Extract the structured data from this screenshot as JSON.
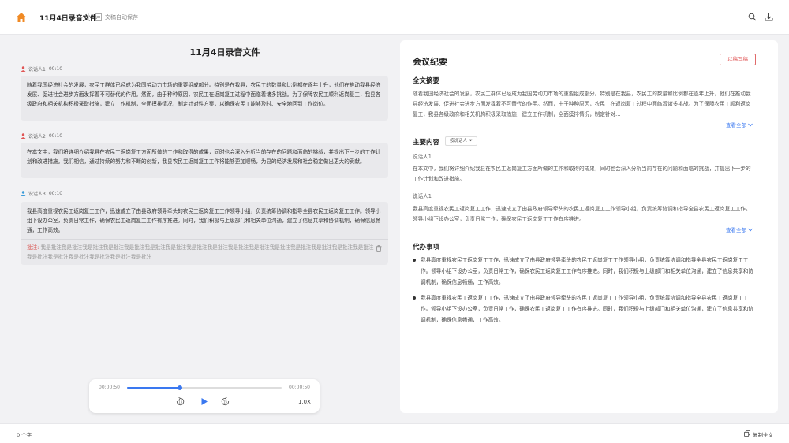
{
  "header": {
    "title": "11月4日录音文件",
    "save_status": "文稿自动保存"
  },
  "transcript": {
    "title": "11月4日录音文件",
    "entries": [
      {
        "speaker": "说话人1",
        "time": "00:10",
        "speaker_color": "#e05555",
        "text": "随着我国经济社会的发展，农民工群体已经成为我国劳动力市场的重要组成部分。特别是在我县，农民工的数量和比例都在逐年上升，他们在推动我县经济发展、促进社会进步方面发挥着不可替代的作用。然而，由于种种原因，农民工在返岗复工过程中面临着诸多挑战。为了保障农民工顺利返岗复工，我县各级政府和相关机构积极采取措施，建立工作机制，全面摸排情况，制定针对性方案，以确保农民工能够及时、安全地回到工作岗位。"
      },
      {
        "speaker": "说话人2",
        "time": "00:10",
        "speaker_color": "#e05555",
        "text": "在本文中，我们将详细介绍我县在农民工返岗复工方面所做的工作和取得的成果，同时也会深入分析当前存在的问题和面临的挑战，并提出下一步的工作计划和改进措施。我们相信，通过持续的努力和不断的创新，我县农民工返岗复工工作将能够更加顺畅，为县的经济发展和社会稳定做出更大的贡献。"
      },
      {
        "speaker": "说话人3",
        "time": "00:10",
        "speaker_color": "#3a9bd9",
        "text": "我县高度重视农民工返岗复工工作，迅速成立了由县政府领导牵头的农民工返岗复工工作领导小组，负责统筹协调和指导全县农民工返岗复工工作。领导小组下设办公室，负责日常工作，确保农民工返岗复工工作有序推进。同时，我们积极与上级部门和相关单位沟通，建立了信息共享和协调机制，确保信息畅通，工作高效。",
        "note_label": "批注:",
        "note_text": "我是批注我是批注我是批注我是批注我是批注我是批注我是批注我是批注我是批注我是批注我是批注我是批注我是批注我是批注我是批注我是批注我是批注我是批注我是批注我是批注我是批注我是批注"
      }
    ]
  },
  "player": {
    "current_time": "00:00:50",
    "total_time": "00:00:50",
    "progress": 0.34,
    "speed": "1.0X",
    "accent": "#3a78f0"
  },
  "summary": {
    "title": "会议纪要",
    "button_label": "以稿写稿",
    "abstract_heading": "全文摘要",
    "abstract_text": "随着我国经济社会的发展，农民工群体已经成为我国劳动力市场的重要组成部分。特别是在我县，农民工的数量和比例都在逐年上升，他们在推动我县经济发展、促进社会进步方面发挥着不可替代的作用。然而，由于种种原因，农民工在返岗复工过程中面临着诸多挑战。为了保障农民工顺利返岗复工，我县各级政府和相关机构积极采取措施，建立工作机制，全面摸排情况，制定针对...",
    "view_all": "查看全部",
    "main_heading": "主要内容",
    "speaker_select": "按说话人",
    "main_items": [
      {
        "speaker": "说话人1",
        "text": "在本文中，我们将详细介绍我县在农民工返岗复工方面所做的工作和取得的成果，同时也会深入分析当前存在的问题和面临的挑战，并提出下一步的工作计划和改进措施。"
      },
      {
        "speaker": "说话人1",
        "text": "我县高度重视农民工返岗复工工作，迅速成立了由县政府领导牵头的农民工返岗复工工作领导小组，负责统筹协调和指导全县农民工返岗复工工作。领导小组下设办公室，负责日常工作，确保农民工返岗复工工作有序推进。"
      }
    ],
    "view_all_2": "查看全部",
    "todo_heading": "代办事项",
    "todos": [
      "我县高度重视农民工返岗复工工作，迅速成立了由县政府领导牵头的农民工返岗复工工作领导小组，负责统筹协调和指导全县农民工返岗复工工作。领导小组下设办公室，负责日常工作，确保农民工返岗复工工作有序推进。同时，我们积极与上级部门和相关单位沟通，建立了信息共享和协调机制，确保信息畅通，工作高效。",
      "我县高度重视农民工返岗复工工作，迅速成立了由县政府领导牵头的农民工返岗复工工作领导小组，负责统筹协调和指导全县农民工返岗复工工作。领导小组下设办公室，负责日常工作，确保农民工返岗复工工作有序推进。同时，我们积极与上级部门和相关单位沟通，建立了信息共享和协调机制，确保信息畅通，工作高效。"
    ]
  },
  "footer": {
    "word_count": "0 个字",
    "copy_label": "复制全文"
  }
}
